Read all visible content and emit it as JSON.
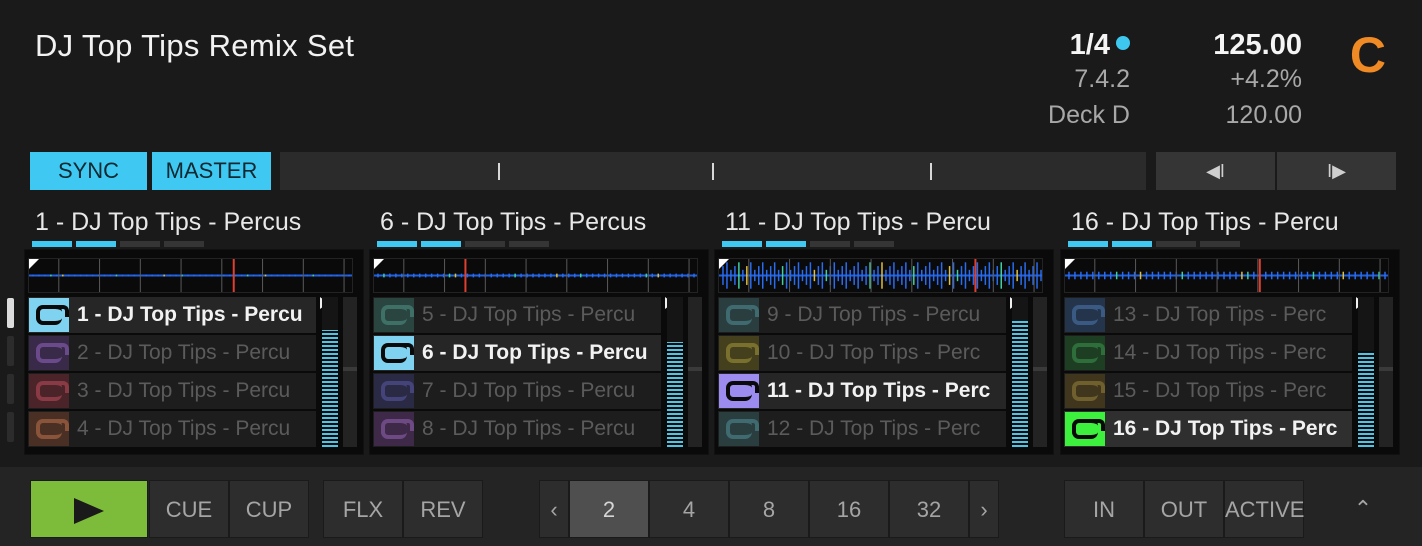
{
  "deck": {
    "title": "DJ Top Tips Remix Set",
    "loop_size": "1/4",
    "version": "7.4.2",
    "sync_source": "Deck D",
    "bpm": "125.00",
    "tempo_offset": "+4.2%",
    "original_bpm": "120.00",
    "deck_letter": "C",
    "accent_color": "#3fc9f2",
    "deck_color": "#f08a24"
  },
  "transport": {
    "sync_label": "SYNC",
    "master_label": "MASTER",
    "nudge_back": "◀I",
    "nudge_forward": "I▶"
  },
  "slots": [
    {
      "title": "1 - DJ Top Tips - Percus",
      "tabs_on": 2,
      "level": 0.78,
      "cells": [
        {
          "label": "1 - DJ Top Tips - Percu",
          "icon_color": "#7fd3f0",
          "icon_border": "#0a0a0a",
          "state": "active"
        },
        {
          "label": "2 - DJ Top Tips - Percu",
          "icon_color": "#3a2a4a",
          "icon_border": "#6a4a8a",
          "state": "idle"
        },
        {
          "label": "3 - DJ Top Tips - Percu",
          "icon_color": "#4a2428",
          "icon_border": "#8a3a44",
          "state": "idle"
        },
        {
          "label": "4 - DJ Top Tips - Percu",
          "icon_color": "#4a3024",
          "icon_border": "#8a543a",
          "state": "idle"
        }
      ]
    },
    {
      "title": "6 - DJ Top Tips - Percus",
      "tabs_on": 2,
      "level": 0.7,
      "cells": [
        {
          "label": "5 - DJ Top Tips - Percu",
          "icon_color": "#2a4440",
          "icon_border": "#3e7068",
          "state": "idle"
        },
        {
          "label": "6 - DJ Top Tips - Percu",
          "icon_color": "#7fd3f0",
          "icon_border": "#0a0a0a",
          "state": "active"
        },
        {
          "label": "7 - DJ Top Tips - Percu",
          "icon_color": "#2a2a44",
          "icon_border": "#44447a",
          "state": "idle"
        },
        {
          "label": "8 - DJ Top Tips - Percu",
          "icon_color": "#3e2a48",
          "icon_border": "#6e4a84",
          "state": "idle"
        }
      ]
    },
    {
      "title": "11 - DJ Top Tips - Percu",
      "tabs_on": 2,
      "level": 0.84,
      "cells": [
        {
          "label": "9 - DJ Top Tips - Percu",
          "icon_color": "#2a3e40",
          "icon_border": "#3e6a70",
          "state": "idle"
        },
        {
          "label": "10 - DJ Top Tips - Perc",
          "icon_color": "#44401e",
          "icon_border": "#7a702e",
          "state": "idle"
        },
        {
          "label": "11 - DJ Top Tips - Perc",
          "icon_color": "#9c8cf0",
          "icon_border": "#0a0a0a",
          "state": "active"
        },
        {
          "label": "12 - DJ Top Tips - Perc",
          "icon_color": "#2a3e40",
          "icon_border": "#3e6a70",
          "state": "idle"
        }
      ]
    },
    {
      "title": "16 - DJ Top Tips - Percu",
      "tabs_on": 2,
      "level": 0.64,
      "cells": [
        {
          "label": "13 - DJ Top Tips - Perc",
          "icon_color": "#24344a",
          "icon_border": "#3a5a84",
          "state": "idle"
        },
        {
          "label": "14 - DJ Top Tips - Perc",
          "icon_color": "#1e3e24",
          "icon_border": "#2e6e3a",
          "state": "idle"
        },
        {
          "label": "15 - DJ Top Tips - Perc",
          "icon_color": "#40361e",
          "icon_border": "#70602e",
          "state": "idle"
        },
        {
          "label": "16 - DJ Top Tips - Perc",
          "icon_color": "#3ef03e",
          "icon_border": "#0a0a0a",
          "state": "selected"
        }
      ]
    }
  ],
  "bottom": {
    "cue_label": "CUE",
    "cup_label": "CUP",
    "flx_label": "FLX",
    "rev_label": "REV",
    "prev_label": "‹",
    "next_label": "›",
    "loop_sizes": [
      "2",
      "4",
      "8",
      "16",
      "32"
    ],
    "selected_loop": "2",
    "in_label": "IN",
    "out_label": "OUT",
    "active_label": "ACTIVE",
    "collapse_label": "⌃",
    "play_color": "#7dbb3a"
  }
}
